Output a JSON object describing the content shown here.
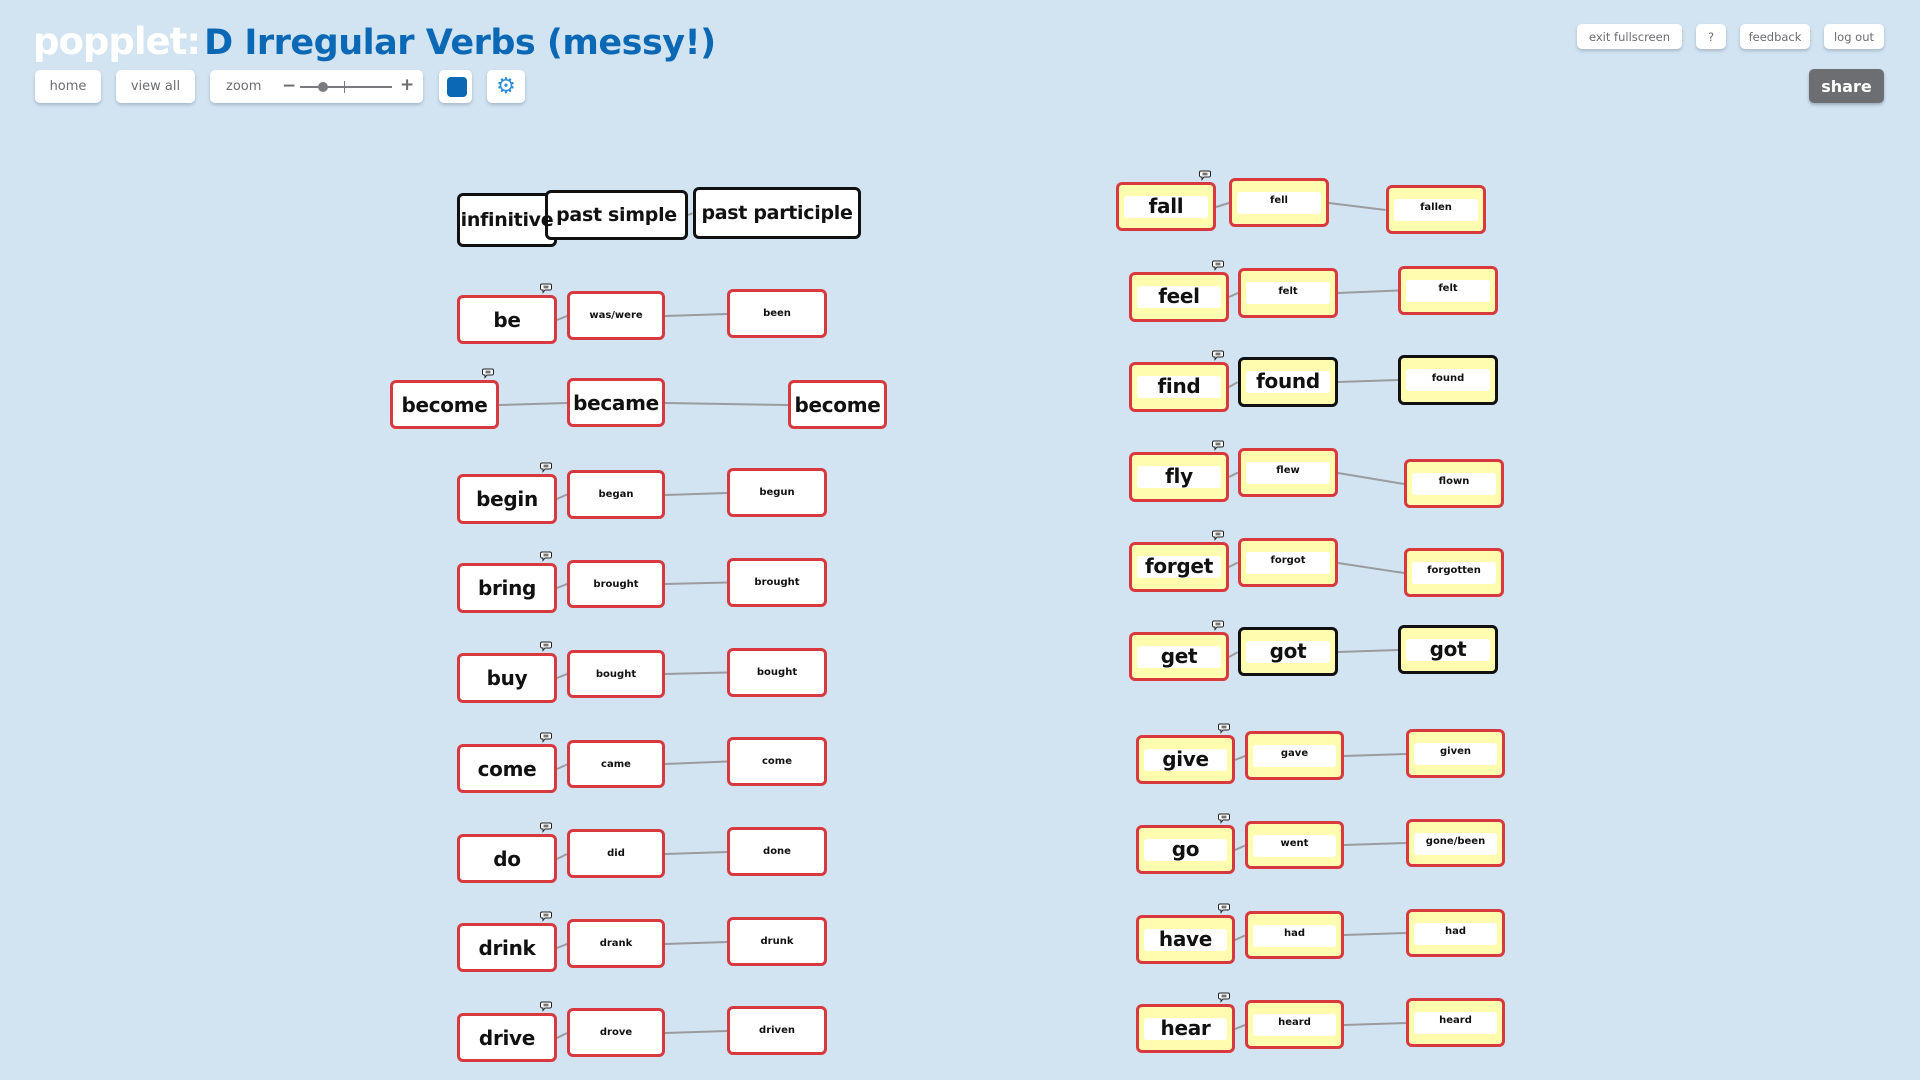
{
  "app": {
    "logo": "popplet:",
    "title": "D Irregular Verbs (messy!)"
  },
  "toolbar": {
    "home_label": "home",
    "view_all_label": "view all",
    "zoom_label": "zoom",
    "zoom_level": 0.25,
    "color_swatch": "#0a68b4",
    "settings_icon": "gear-icon"
  },
  "top_right": {
    "exit_fullscreen_label": "exit fullscreen",
    "help_label": "?",
    "feedback_label": "feedback",
    "logout_label": "log out",
    "share_label": "share"
  },
  "colors": {
    "background": "#d2e4f2",
    "border_red": "#d8393f",
    "border_black": "#111111",
    "node_yellow": "#fffcb0",
    "title_blue": "#0a68b4"
  },
  "headers": [
    "infinitive",
    "past simple",
    "past participle"
  ],
  "left_verbs": [
    {
      "infinitive": "be",
      "past_simple": "was/were",
      "past_participle": "been",
      "has_comment": true
    },
    {
      "infinitive": "become",
      "past_simple": "became",
      "past_participle": "become",
      "has_comment": true
    },
    {
      "infinitive": "begin",
      "past_simple": "began",
      "past_participle": "begun",
      "has_comment": true
    },
    {
      "infinitive": "bring",
      "past_simple": "brought",
      "past_participle": "brought",
      "has_comment": true
    },
    {
      "infinitive": "buy",
      "past_simple": "bought",
      "past_participle": "bought",
      "has_comment": true
    },
    {
      "infinitive": "come",
      "past_simple": "came",
      "past_participle": "come",
      "has_comment": true
    },
    {
      "infinitive": "do",
      "past_simple": "did",
      "past_participle": "done",
      "has_comment": true
    },
    {
      "infinitive": "drink",
      "past_simple": "drank",
      "past_participle": "drunk",
      "has_comment": true
    },
    {
      "infinitive": "drive",
      "past_simple": "drove",
      "past_participle": "driven",
      "has_comment": true
    }
  ],
  "right_verbs": [
    {
      "infinitive": "fall",
      "past_simple": "fell",
      "past_participle": "fallen",
      "has_comment": true
    },
    {
      "infinitive": "feel",
      "past_simple": "felt",
      "past_participle": "felt",
      "has_comment": true
    },
    {
      "infinitive": "find",
      "past_simple": "found",
      "past_participle": "found",
      "has_comment": true
    },
    {
      "infinitive": "fly",
      "past_simple": "flew",
      "past_participle": "flown",
      "has_comment": true
    },
    {
      "infinitive": "forget",
      "past_simple": "forgot",
      "past_participle": "forgotten",
      "has_comment": true
    },
    {
      "infinitive": "get",
      "past_simple": "got",
      "past_participle": "got",
      "has_comment": true
    },
    {
      "infinitive": "give",
      "past_simple": "gave",
      "past_participle": "given",
      "has_comment": true
    },
    {
      "infinitive": "go",
      "past_simple": "went",
      "past_participle": "gone/been",
      "has_comment": true
    },
    {
      "infinitive": "have",
      "past_simple": "had",
      "past_participle": "had",
      "has_comment": true
    },
    {
      "infinitive": "hear",
      "past_simple": "heard",
      "past_participle": "heard",
      "has_comment": true
    }
  ]
}
